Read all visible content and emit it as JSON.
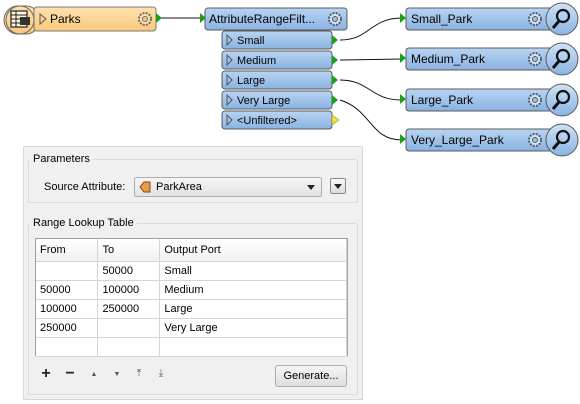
{
  "workspace": {
    "reader": {
      "label": "Parks"
    },
    "transformer": {
      "label": "AttributeRangeFilt...",
      "ports": [
        "Small",
        "Medium",
        "Large",
        "Very Large",
        "<Unfiltered>"
      ]
    },
    "outputs": [
      "Small_Park",
      "Medium_Park",
      "Large_Park",
      "Very_Large_Park"
    ]
  },
  "dialog": {
    "parameters_title": "Parameters",
    "source_attribute_label": "Source Attribute:",
    "source_attribute_value": "ParkArea",
    "range_table_title": "Range Lookup Table",
    "columns": [
      "From",
      "To",
      "Output Port"
    ],
    "rows": [
      [
        "",
        "50000",
        "Small"
      ],
      [
        "50000",
        "100000",
        "Medium"
      ],
      [
        "100000",
        "250000",
        "Large"
      ],
      [
        "250000",
        "",
        "Very Large"
      ],
      [
        "",
        "",
        ""
      ]
    ],
    "toolbar": {
      "add": "+",
      "remove": "−",
      "move_up": "▲",
      "move_down": "▼",
      "move_top": "⤒",
      "move_bottom": "⤓",
      "generate_label": "Generate..."
    }
  },
  "colors": {
    "reader_fill": "#fcd69a",
    "transformer_fill": "#9fc2ea",
    "port_fill": "#a9c8ec",
    "connector_green": "#1aa01a",
    "connector_yellow": "#f0e040"
  }
}
